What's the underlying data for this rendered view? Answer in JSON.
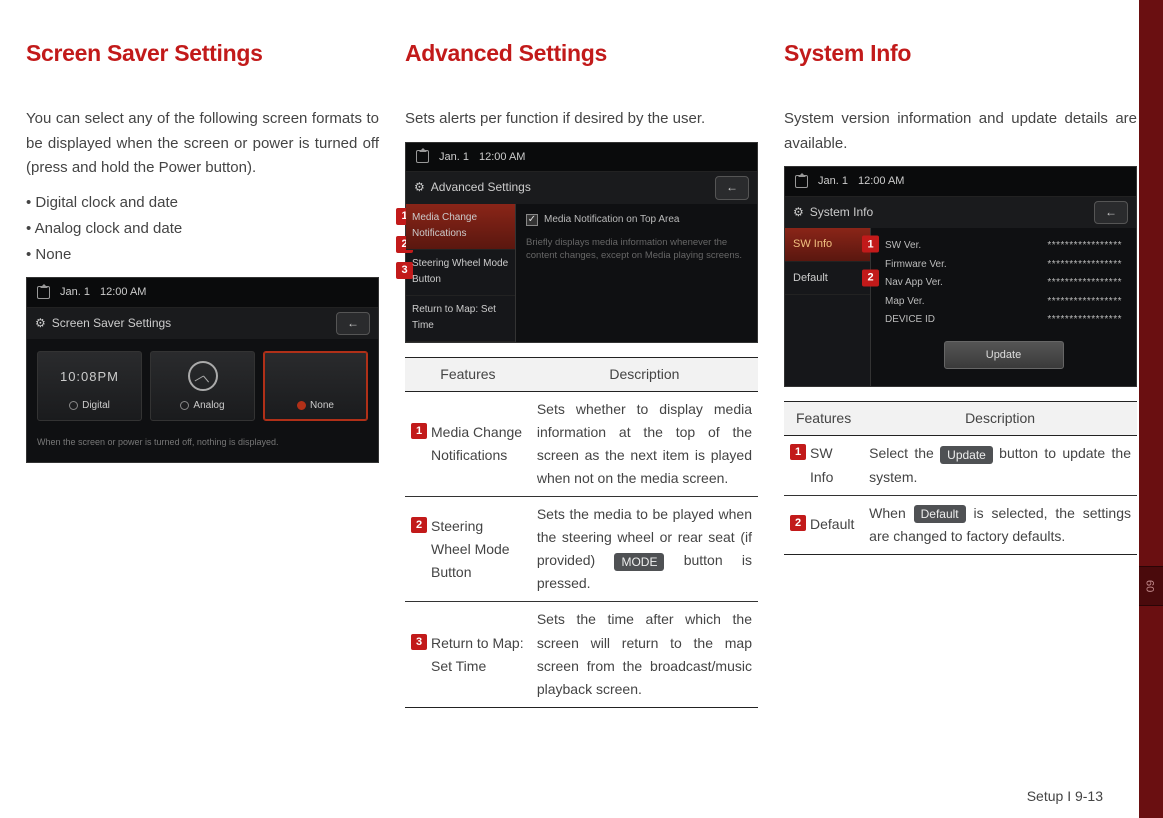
{
  "col1": {
    "heading": "Screen Saver Settings",
    "intro": "You can select any of the following screen formats to be displayed when the screen or power is turned off (press and hold the Power button).",
    "bullets": [
      "Digital clock and date",
      "Analog clock and date",
      "None"
    ],
    "shot": {
      "date": "Jan. 1",
      "time": "12:00 AM",
      "title": "Screen Saver Settings",
      "digital_time": "10:08PM",
      "opts": {
        "digital": "Digital",
        "analog": "Analog",
        "none": "None"
      },
      "note": "When the screen or power is turned off, nothing is displayed."
    }
  },
  "col2": {
    "heading": "Advanced Settings",
    "intro": "Sets alerts per function if desired by the user.",
    "shot": {
      "date": "Jan. 1",
      "time": "12:00 AM",
      "title": "Advanced Settings",
      "side": [
        "Media Change Notifications",
        "Steering Wheel Mode Button",
        "Return to Map: Set Time"
      ],
      "checkbox_label": "Media Notification on Top Area",
      "sub": "Briefly displays media information whenever the content changes, except on Media playing screens."
    },
    "table": {
      "headers": [
        "Features",
        "Description"
      ],
      "rows": [
        {
          "n": "1",
          "name": "Media Change Notifications",
          "desc": "Sets whether to display media information at the top of the screen as the next item is played when not on the media screen."
        },
        {
          "n": "2",
          "name": "Steering Wheel Mode Button",
          "desc_pre": "Sets the media to be played when the steering wheel or rear seat (if provided) ",
          "btn": "MODE",
          "desc_post": " button is pressed."
        },
        {
          "n": "3",
          "name": "Return to Map: Set Time",
          "desc": "Sets the time after which the screen will return to the map screen from the broadcast/music playback screen."
        }
      ]
    }
  },
  "col3": {
    "heading": "System Info",
    "intro": "System version information and update details are available.",
    "shot": {
      "date": "Jan. 1",
      "time": "12:00 AM",
      "title": "System Info",
      "side": [
        "SW Info",
        "Default"
      ],
      "fields": [
        "SW Ver.",
        "Firmware Ver.",
        "Nav App Ver.",
        "Map Ver.",
        "DEVICE ID"
      ],
      "update": "Update"
    },
    "table": {
      "headers": [
        "Features",
        "Description"
      ],
      "rows": [
        {
          "n": "1",
          "name": "SW Info",
          "desc_pre": "Select the ",
          "btn": "Update",
          "desc_post": " button to update the system."
        },
        {
          "n": "2",
          "name": "Default",
          "desc_pre": "When ",
          "btn": "Default",
          "desc_post": " is selected, the settings are changed to factory defaults."
        }
      ]
    }
  },
  "side_tab": "09",
  "footer": "Setup I 9-13"
}
